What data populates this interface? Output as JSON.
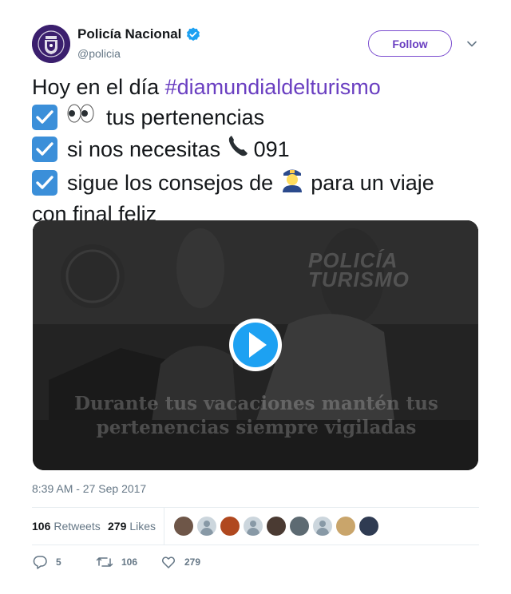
{
  "author": {
    "name": "Policía Nacional",
    "handle": "@policia",
    "verified": true
  },
  "follow_label": "Follow",
  "tweet": {
    "line1_prefix": "Hoy en el día ",
    "hashtag": "#diamundialdelturismo",
    "line2": "tus pertenencias",
    "line3_text": "si nos necesitas",
    "line3_number": "091",
    "line4": "sigue los consejos de",
    "line4_suffix": "para un viaje",
    "line5": "con final feliz"
  },
  "video": {
    "overlay_logo_line1": "POLICÍA",
    "overlay_logo_line2": "TURISMO",
    "overlay_caption_line1": "Durante tus vacaciones mantén tus",
    "overlay_caption_line2": "pertenencias siempre vigiladas"
  },
  "timestamp": "8:39 AM - 27 Sep 2017",
  "stats": {
    "retweets_count": "106",
    "retweets_label": "Retweets",
    "likes_count": "279",
    "likes_label": "Likes"
  },
  "actions": {
    "reply_count": "5",
    "retweet_count": "106",
    "like_count": "279"
  },
  "colors": {
    "brand": "#6a3fc1",
    "play_button": "#1da1f2",
    "verified": "#1da1f2"
  }
}
